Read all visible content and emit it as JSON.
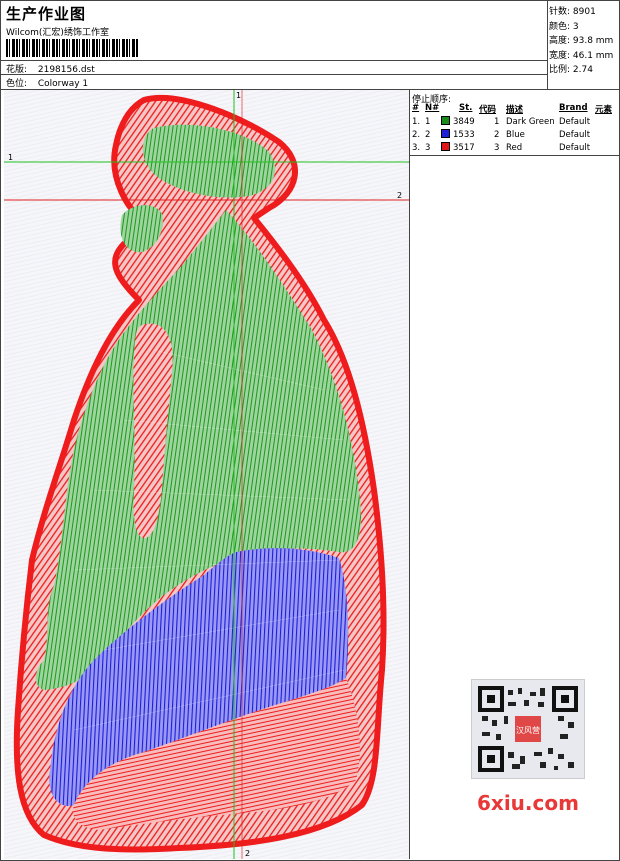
{
  "header": {
    "title": "生产作业图",
    "studio": "Wilcom(汇宏)绣饰工作室",
    "design_label": "花版:",
    "design_value": "2198156.dst",
    "color_label": "色位:",
    "color_value": "Colorway 1"
  },
  "stats": {
    "stitches": "针数: 8901",
    "colors": "颜色: 3",
    "height": "高度: 93.8 mm",
    "width": "宽度: 46.1 mm",
    "scale": "比例: 2.74"
  },
  "guides": {
    "v_top": "1",
    "v_bottom": "2",
    "h_left": "1",
    "h_right": "2"
  },
  "stop_sequence": {
    "title": "停止顺序:",
    "headers": {
      "num": "#",
      "n": "N#",
      "st": "St.",
      "code": "代码",
      "desc": "描述",
      "brand": "Brand",
      "elem": "元素"
    },
    "rows": [
      {
        "num": "1.",
        "n": "1",
        "color": "#1a8a1a",
        "st": "3849",
        "code": "1",
        "desc": "Dark Green",
        "brand": "Default"
      },
      {
        "num": "2.",
        "n": "2",
        "color": "#1f1fd8",
        "st": "1533",
        "code": "2",
        "desc": "Blue",
        "brand": "Default"
      },
      {
        "num": "3.",
        "n": "3",
        "color": "#e01818",
        "st": "3517",
        "code": "3",
        "desc": "Red",
        "brand": "Default"
      }
    ]
  },
  "watermark": {
    "text": "6xiu.com",
    "qr_badge": "汉风营"
  },
  "colors": {
    "green": "#1a9a1a",
    "blue": "#1c1ce0",
    "red": "#ee1c1c",
    "guide_green": "#20c020",
    "guide_red": "#e02020"
  }
}
